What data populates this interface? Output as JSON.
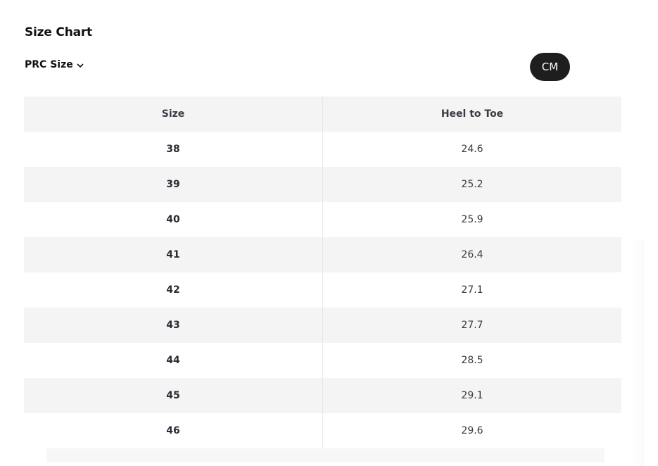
{
  "title": "Size Chart",
  "size_system": {
    "selected": "PRC Size",
    "icon": "chevron-down-icon"
  },
  "unit_toggle": {
    "label": "CM"
  },
  "table": {
    "headers": {
      "size": "Size",
      "heel_to_toe": "Heel to Toe"
    },
    "rows": [
      {
        "size": "38",
        "heel_to_toe": "24.6"
      },
      {
        "size": "39",
        "heel_to_toe": "25.2"
      },
      {
        "size": "40",
        "heel_to_toe": "25.9"
      },
      {
        "size": "41",
        "heel_to_toe": "26.4"
      },
      {
        "size": "42",
        "heel_to_toe": "27.1"
      },
      {
        "size": "43",
        "heel_to_toe": "27.7"
      },
      {
        "size": "44",
        "heel_to_toe": "28.5"
      },
      {
        "size": "45",
        "heel_to_toe": "29.1"
      },
      {
        "size": "46",
        "heel_to_toe": "29.6"
      }
    ]
  },
  "colors": {
    "toggle_bg": "#1e1e1e",
    "alt_row_bg": "#f4f4f4",
    "text": "#1b1b1b"
  }
}
